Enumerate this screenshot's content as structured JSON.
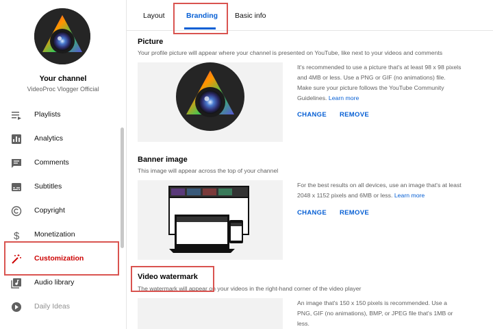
{
  "sidebar": {
    "channel_title": "Your channel",
    "channel_name": "VideoProc Vlogger Official",
    "items": [
      {
        "label": "Playlists",
        "icon": "playlist-icon"
      },
      {
        "label": "Analytics",
        "icon": "analytics-icon"
      },
      {
        "label": "Comments",
        "icon": "comments-icon"
      },
      {
        "label": "Subtitles",
        "icon": "subtitles-icon"
      },
      {
        "label": "Copyright",
        "icon": "copyright-icon"
      },
      {
        "label": "Monetization",
        "icon": "dollar-icon"
      },
      {
        "label": "Customization",
        "icon": "magic-wand-icon"
      },
      {
        "label": "Audio library",
        "icon": "audio-library-icon"
      },
      {
        "label": "Daily Ideas",
        "icon": "daily-ideas-icon"
      }
    ]
  },
  "tabs": [
    "Layout",
    "Branding",
    "Basic info"
  ],
  "picture": {
    "title": "Picture",
    "description": "Your profile picture will appear where your channel is presented on YouTube, like next to your videos and comments",
    "info": "It's recommended to use a picture that's at least 98 x 98 pixels and 4MB or less. Use a PNG or GIF (no animations) file. Make sure your picture follows the YouTube Community Guidelines.",
    "link": "Learn more",
    "change": "CHANGE",
    "remove": "REMOVE"
  },
  "banner": {
    "title": "Banner image",
    "description": "This image will appear across the top of your channel",
    "info": "For the best results on all devices, use an image that's at least 2048 x 1152 pixels and 6MB or less.",
    "link": "Learn more",
    "change": "CHANGE",
    "remove": "REMOVE"
  },
  "watermark": {
    "title": "Video watermark",
    "description": "The watermark will appear on your videos in the right-hand corner of the video player",
    "info": "An image that's 150 x 150 pixels is recommended. Use a PNG, GIF (no animations), BMP, or JPEG file that's 1MB or less."
  },
  "colors": {
    "accent": "#065fd4",
    "active_nav": "#cc0000",
    "highlight_border": "#d9534f"
  }
}
